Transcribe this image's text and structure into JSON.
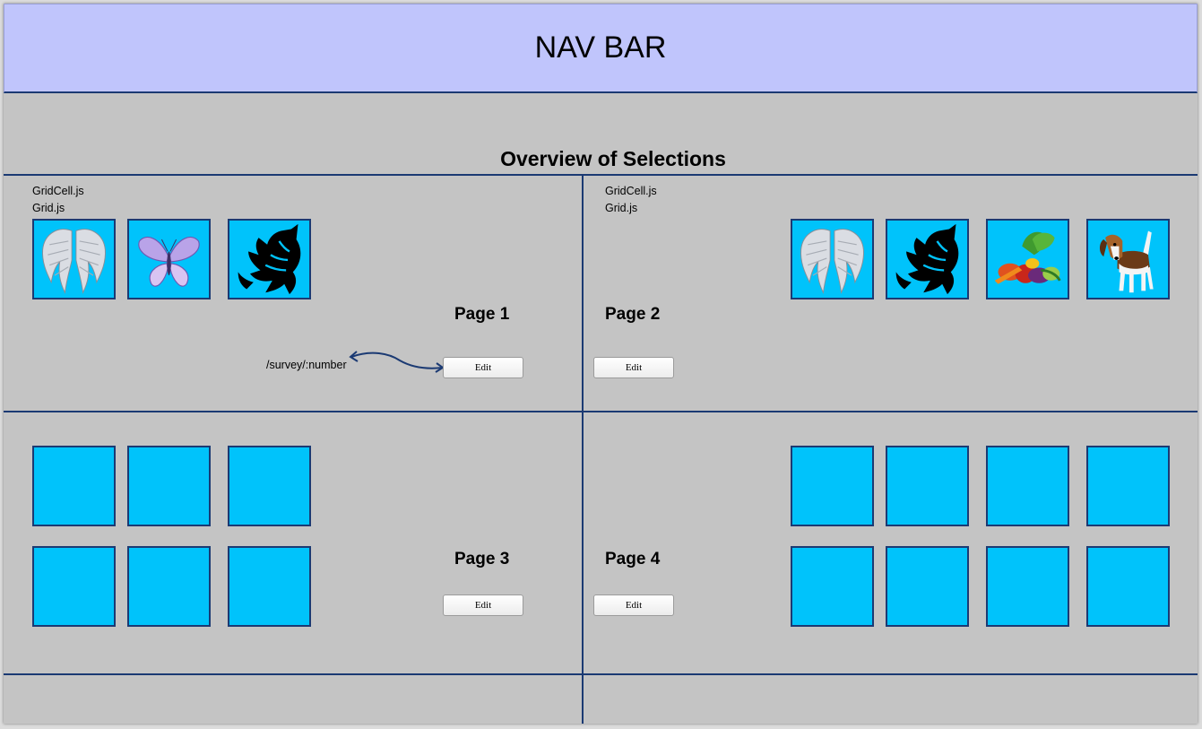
{
  "navbar": {
    "title": "NAV BAR"
  },
  "overview": {
    "title": "Overview of Selections"
  },
  "annotation": {
    "route": "/survey/:number"
  },
  "colors": {
    "navbar_bg": "#c0c5fc",
    "page_bg": "#c4c4c4",
    "cell_bg": "#00c3fb",
    "border": "#1b3a73"
  },
  "pages": [
    {
      "label": "Page 1",
      "edit_label": "Edit",
      "files": [
        "GridCell.js",
        "Grid.js"
      ],
      "cells": [
        "angel-wings-icon",
        "butterfly-icon",
        "tribal-wolf-icon"
      ]
    },
    {
      "label": "Page 2",
      "edit_label": "Edit",
      "files": [
        "GridCell.js",
        "Grid.js"
      ],
      "cells": [
        "angel-wings-icon",
        "tribal-wolf-icon",
        "vegetables-icon",
        "beagle-dog-icon"
      ]
    },
    {
      "label": "Page 3",
      "edit_label": "Edit",
      "cells": [
        "empty",
        "empty",
        "empty",
        "empty",
        "empty",
        "empty"
      ]
    },
    {
      "label": "Page 4",
      "edit_label": "Edit",
      "cells": [
        "empty",
        "empty",
        "empty",
        "empty",
        "empty",
        "empty",
        "empty",
        "empty"
      ]
    }
  ]
}
